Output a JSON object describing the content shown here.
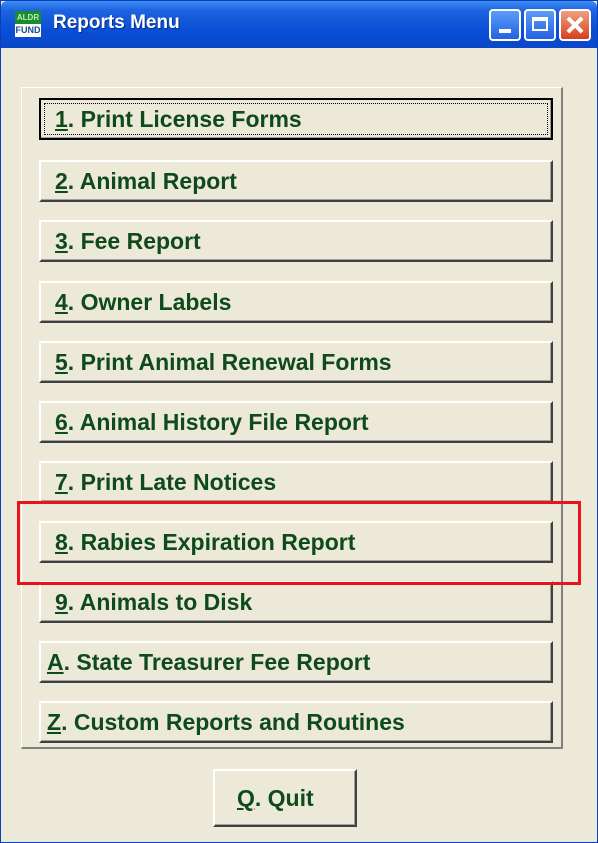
{
  "window": {
    "title": "Reports Menu",
    "icon_top": "ALDR",
    "icon_bottom": "FUND"
  },
  "menu": [
    {
      "key": "1",
      "label": ". Print License Forms"
    },
    {
      "key": "2",
      "label": ".  Animal Report"
    },
    {
      "key": "3",
      "label": ".  Fee Report"
    },
    {
      "key": "4",
      "label": ".  Owner Labels"
    },
    {
      "key": "5",
      "label": ". Print Animal Renewal Forms"
    },
    {
      "key": "6",
      "label": ". Animal History File Report"
    },
    {
      "key": "7",
      "label": ".  Print Late Notices"
    },
    {
      "key": "8",
      "label": ". Rabies Expiration Report"
    },
    {
      "key": "9",
      "label": ".  Animals to Disk"
    },
    {
      "key": "A",
      "label": ". State Treasurer Fee Report"
    },
    {
      "key": "Z",
      "label": ". Custom Reports and Routines"
    }
  ],
  "quit": {
    "key": "Q",
    "label": ".  Quit"
  },
  "colors": {
    "text": "#0e4a1c",
    "highlight": "#e8141c",
    "titlebar": "#0a4fd6"
  }
}
